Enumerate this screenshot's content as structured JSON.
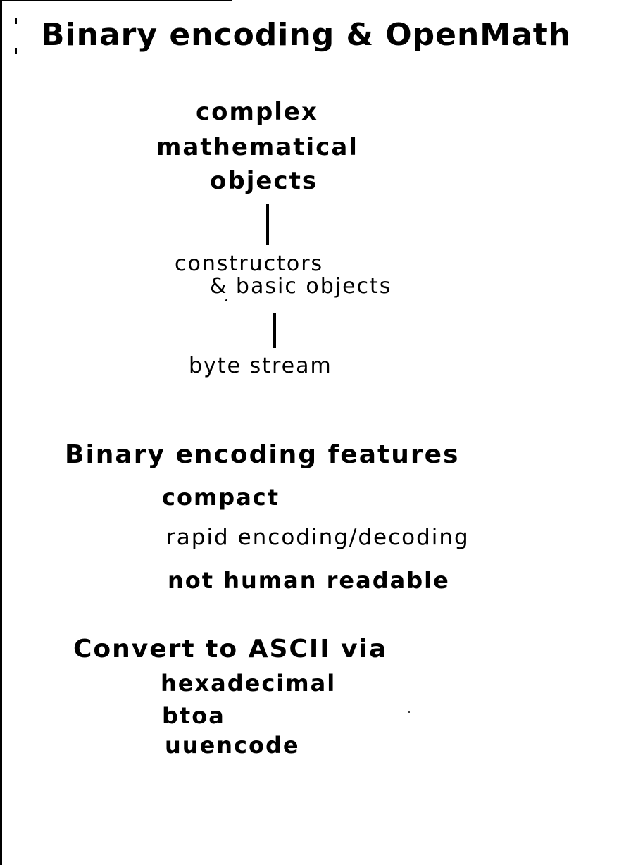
{
  "title": "Binary encoding & OpenMath",
  "diagram": {
    "top_node": [
      "complex",
      "mathematical",
      "objects"
    ],
    "middle_node": [
      "constructors",
      "& basic objects"
    ],
    "bottom_node": "byte stream"
  },
  "features": {
    "heading": "Binary encoding features",
    "items": [
      "compact",
      "rapid encoding/decoding",
      "not human readable"
    ]
  },
  "convert": {
    "heading": "Convert to ASCII via",
    "items": [
      "hexadecimal",
      "btoa",
      "uuencode"
    ]
  }
}
